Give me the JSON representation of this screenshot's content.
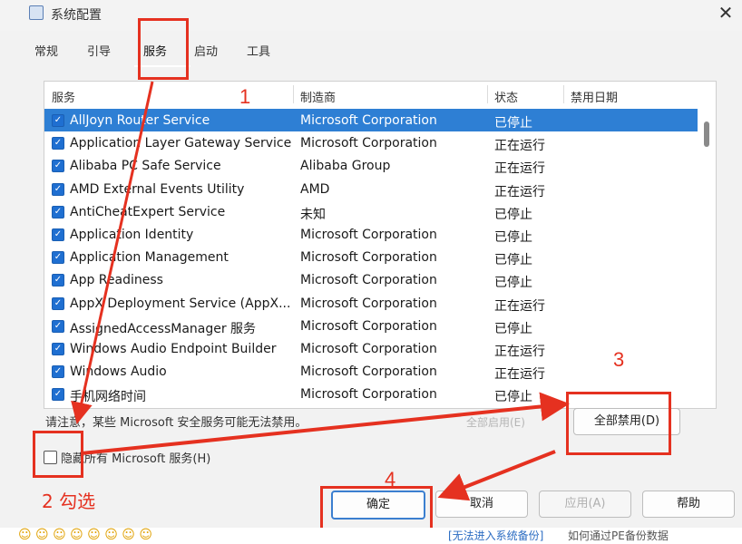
{
  "window": {
    "title": "系统配置",
    "close_glyph": "✕"
  },
  "tabs": [
    "常规",
    "引导",
    "服务",
    "启动",
    "工具"
  ],
  "active_tab": "服务",
  "table": {
    "headers": {
      "service": "服务",
      "manufacturer": "制造商",
      "status": "状态",
      "disabled_date": "禁用日期"
    },
    "rows": [
      {
        "service": "AllJoyn Router Service",
        "manufacturer": "Microsoft Corporation",
        "status": "已停止",
        "date": "",
        "checked": true,
        "selected": true
      },
      {
        "service": "Application Layer Gateway Service",
        "manufacturer": "Microsoft Corporation",
        "status": "正在运行",
        "date": "",
        "checked": true
      },
      {
        "service": "Alibaba PC Safe Service",
        "manufacturer": "Alibaba Group",
        "status": "正在运行",
        "date": "",
        "checked": true
      },
      {
        "service": "AMD External Events Utility",
        "manufacturer": "AMD",
        "status": "正在运行",
        "date": "",
        "checked": true
      },
      {
        "service": "AntiCheatExpert Service",
        "manufacturer": "未知",
        "status": "已停止",
        "date": "",
        "checked": true
      },
      {
        "service": "Application Identity",
        "manufacturer": "Microsoft Corporation",
        "status": "已停止",
        "date": "",
        "checked": true
      },
      {
        "service": "Application Management",
        "manufacturer": "Microsoft Corporation",
        "status": "已停止",
        "date": "",
        "checked": true
      },
      {
        "service": "App Readiness",
        "manufacturer": "Microsoft Corporation",
        "status": "已停止",
        "date": "",
        "checked": true
      },
      {
        "service": "AppX Deployment Service (AppX...",
        "manufacturer": "Microsoft Corporation",
        "status": "正在运行",
        "date": "",
        "checked": true
      },
      {
        "service": "AssignedAccessManager 服务",
        "manufacturer": "Microsoft Corporation",
        "status": "已停止",
        "date": "",
        "checked": true
      },
      {
        "service": "Windows Audio Endpoint Builder",
        "manufacturer": "Microsoft Corporation",
        "status": "正在运行",
        "date": "",
        "checked": true
      },
      {
        "service": "Windows Audio",
        "manufacturer": "Microsoft Corporation",
        "status": "正在运行",
        "date": "",
        "checked": true
      },
      {
        "service": "手机网络时间",
        "manufacturer": "Microsoft Corporation",
        "status": "已停止",
        "date": "",
        "checked": true
      }
    ]
  },
  "note": "请注意，某些 Microsoft 安全服务可能无法禁用。",
  "buttons": {
    "enable_all": "全部启用(E)",
    "disable_all": "全部禁用(D)",
    "ok": "确定",
    "cancel": "取消",
    "apply": "应用(A)",
    "help": "帮助"
  },
  "hide_ms": {
    "label": "隐藏所有 Microsoft 服务(H)",
    "checked": false
  },
  "annotations": {
    "step1": "1",
    "step2": "2 勾选",
    "step3": "3",
    "step4": "4",
    "color": "#e53120"
  },
  "footer": {
    "link": "[无法进入系统备份]",
    "text": "如何通过PE备份数据"
  }
}
